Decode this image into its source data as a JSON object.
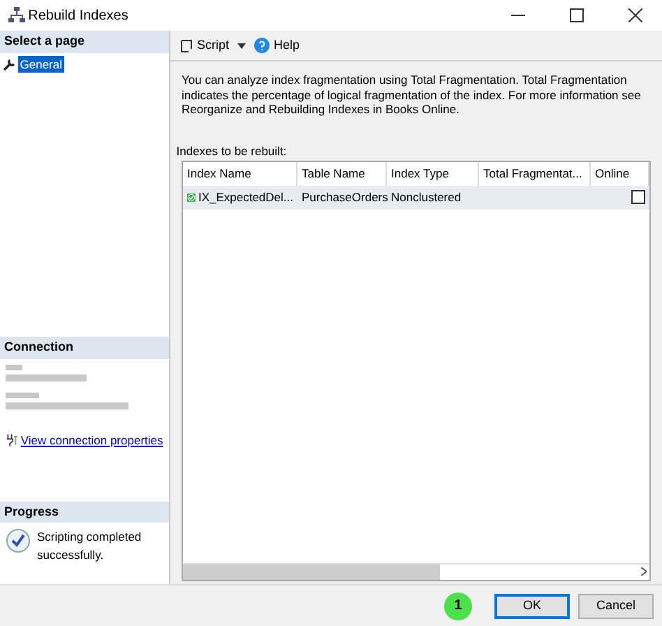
{
  "window": {
    "title": "Rebuild Indexes"
  },
  "sidebar": {
    "header": "Select a page",
    "items": [
      {
        "label": "General",
        "selected": true
      }
    ]
  },
  "connection": {
    "header": "Connection",
    "link": "View connection properties"
  },
  "progress": {
    "header": "Progress",
    "message": "Scripting completed successfully."
  },
  "toolbar": {
    "items": [
      {
        "kind": "script",
        "label": "Script"
      },
      {
        "kind": "help",
        "label": "Help"
      }
    ]
  },
  "description": "You can analyze index fragmentation using Total Fragmentation. Total Fragmentation indicates the percentage of logical fragmentation of the index. For more information see Reorganize and Rebuilding Indexes in Books Online.",
  "table": {
    "label": "Indexes to be rebuilt:",
    "columns": [
      "Index Name",
      "Table Name",
      "Index Type",
      "Total Fragmentat...",
      "Online"
    ],
    "rows": [
      {
        "index_name": "IX_ExpectedDel...",
        "table_name": "PurchaseOrders",
        "index_type": "Nonclustered",
        "online": false
      }
    ]
  },
  "callout": "1",
  "buttons": [
    {
      "label": "OK",
      "selected": true
    },
    {
      "label": "Cancel",
      "selected": false
    }
  ]
}
